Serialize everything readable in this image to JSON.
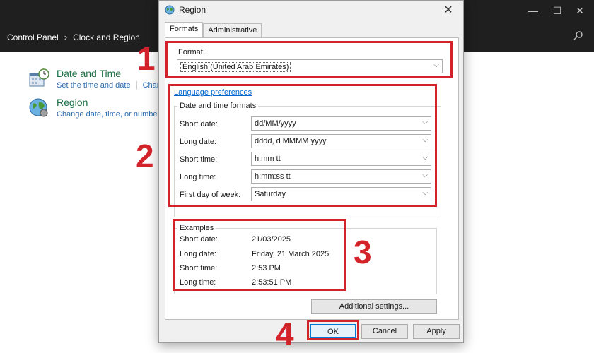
{
  "control_panel": {
    "breadcrumb": [
      "Control Panel",
      "Clock and Region"
    ],
    "items": [
      {
        "title": "Date and Time",
        "links": [
          "Set the time and date",
          "Chan"
        ]
      },
      {
        "title": "Region",
        "links": [
          "Change date, time, or number"
        ]
      }
    ]
  },
  "dialog": {
    "title": "Region",
    "tabs": [
      "Formats",
      "Administrative"
    ],
    "format": {
      "label": "Format:",
      "value": "English (United Arab Emirates)"
    },
    "language_preferences": "Language preferences",
    "date_time_formats": {
      "title": "Date and time formats",
      "rows": [
        {
          "label": "Short date:",
          "value": "dd/MM/yyyy"
        },
        {
          "label": "Long date:",
          "value": "dddd, d MMMM yyyy"
        },
        {
          "label": "Short time:",
          "value": "h:mm tt"
        },
        {
          "label": "Long time:",
          "value": "h:mm:ss tt"
        },
        {
          "label": "First day of week:",
          "value": "Saturday"
        }
      ]
    },
    "examples": {
      "title": "Examples",
      "rows": [
        {
          "label": "Short date:",
          "value": "21/03/2025"
        },
        {
          "label": "Long date:",
          "value": "Friday, 21 March 2025"
        },
        {
          "label": "Short time:",
          "value": "2:53 PM"
        },
        {
          "label": "Long time:",
          "value": "2:53:51 PM"
        }
      ]
    },
    "additional_settings": "Additional settings...",
    "buttons": {
      "ok": "OK",
      "cancel": "Cancel",
      "apply": "Apply"
    }
  },
  "annotations": [
    "1",
    "2",
    "3",
    "4"
  ],
  "colors": {
    "annotation": "#d3232a",
    "link": "#0066cc",
    "cp_title": "#1e7145"
  }
}
